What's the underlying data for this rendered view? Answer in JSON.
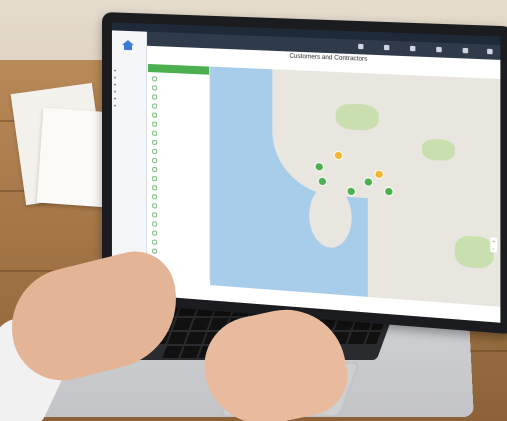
{
  "app": {
    "title": "Customers and Contractors",
    "window_label": "",
    "brand": "",
    "subtitle": ""
  },
  "sidebar": {
    "items": [
      {
        "label": ""
      },
      {
        "label": ""
      },
      {
        "label": ""
      },
      {
        "label": ""
      },
      {
        "label": ""
      },
      {
        "label": ""
      }
    ],
    "footer": ""
  },
  "panel": {
    "header": "",
    "rows": [
      "",
      "",
      "",
      "",
      "",
      "",
      "",
      "",
      "",
      "",
      "",
      "",
      "",
      "",
      "",
      "",
      "",
      "",
      "",
      "",
      ""
    ]
  },
  "map": {
    "pin_colors": [
      "#4caf50",
      "#f2b632"
    ],
    "water_color": "#a8cdea",
    "land_color": "#e8e6df"
  },
  "colors": {
    "accent": "#4caf50",
    "header": "#2f3b4a"
  }
}
